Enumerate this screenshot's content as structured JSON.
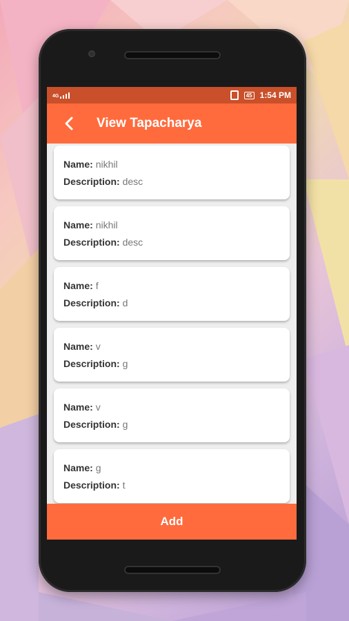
{
  "status_bar": {
    "network": "4G",
    "time": "1:54 PM",
    "battery": "45"
  },
  "app_bar": {
    "title": "View Tapacharya"
  },
  "labels": {
    "name": "Name:",
    "description": "Description:"
  },
  "items": [
    {
      "name": "nikhil",
      "description": "desc"
    },
    {
      "name": "nikhil",
      "description": "desc"
    },
    {
      "name": "f",
      "description": "d"
    },
    {
      "name": "v",
      "description": "g"
    },
    {
      "name": "v",
      "description": "g"
    },
    {
      "name": "g",
      "description": "t"
    }
  ],
  "add_button": {
    "label": "Add"
  },
  "colors": {
    "primary": "#ff6b3d",
    "status_bar": "#c9502a"
  }
}
